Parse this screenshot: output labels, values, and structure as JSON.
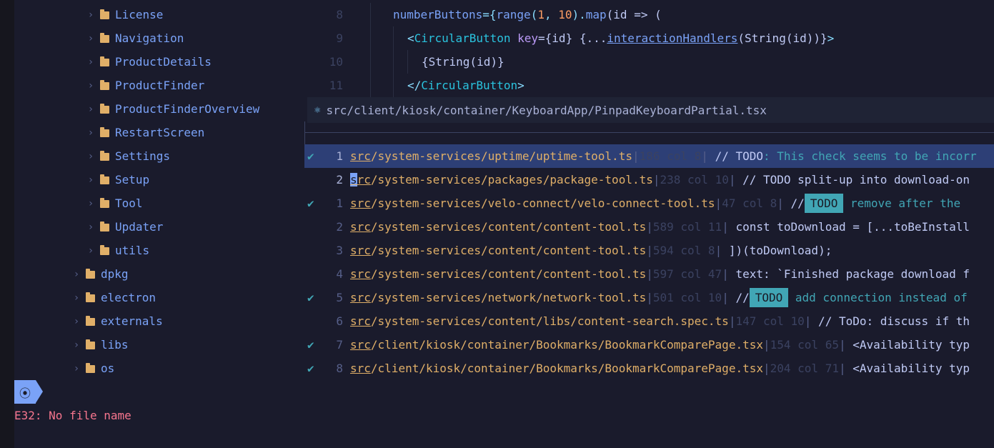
{
  "sidebar": {
    "items": [
      {
        "label": "License",
        "expanded": false
      },
      {
        "label": "Navigation",
        "expanded": false
      },
      {
        "label": "ProductDetails",
        "expanded": false
      },
      {
        "label": "ProductFinder",
        "expanded": false
      },
      {
        "label": "ProductFinderOverview",
        "expanded": false
      },
      {
        "label": "RestartScreen",
        "expanded": false
      },
      {
        "label": "Settings",
        "expanded": false
      },
      {
        "label": "Setup",
        "expanded": false
      },
      {
        "label": "Tool",
        "expanded": false
      },
      {
        "label": "Updater",
        "expanded": false
      },
      {
        "label": "utils",
        "expanded": false
      },
      {
        "label": "dpkg",
        "expanded": false
      },
      {
        "label": "electron",
        "expanded": false
      },
      {
        "label": "externals",
        "expanded": false
      },
      {
        "label": "libs",
        "expanded": false
      },
      {
        "label": "os",
        "expanded": false
      }
    ]
  },
  "code": {
    "lines": [
      {
        "num": "8",
        "indent": 2
      },
      {
        "num": "9",
        "indent": 3
      },
      {
        "num": "10",
        "indent": 4
      },
      {
        "num": "11",
        "indent": 3
      }
    ],
    "line8": {
      "prop": "numberButtons",
      "eq": "={",
      "fn": "range",
      "open": "(",
      "a": "1",
      "comma": ", ",
      "b": "10",
      "close": ").",
      "map": "map",
      "rest": "(id => ("
    },
    "line9": {
      "lt": "<",
      "tag": "CircularButton",
      "key": " key",
      "eq": "={id} {...",
      "handler": "interactionHandlers",
      "args": "(String(id))}",
      "gt": ">"
    },
    "line10": {
      "text": "{String(id)}"
    },
    "line11": {
      "lt": "</",
      "tag": "CircularButton",
      "gt": ">"
    }
  },
  "breadcrumb": {
    "icon": "react-icon",
    "path": "src/client/kiosk/container/KeyboardApp/PinpadKeyboardPartial.tsx"
  },
  "quickfix": {
    "rows": [
      {
        "checked": true,
        "num": "1",
        "src": "src",
        "path": "/system-services/uptime/uptime-tool.ts",
        "loc": "186 col 8",
        "pre": " // ",
        "todo": "TODO",
        "todo_style": "inline",
        "msg": ": This check seems to be incorr",
        "selected": true
      },
      {
        "checked": false,
        "num": "2",
        "src": "src",
        "path": "/system-services/packages/package-tool.ts",
        "loc": "238 col 10",
        "pre": " // TODO split-up into download-on",
        "todo": "",
        "todo_style": "none",
        "msg": "",
        "selected": false,
        "cursor": true
      },
      {
        "checked": true,
        "num": "1",
        "src": "src",
        "path": "/system-services/velo-connect/velo-connect-tool.ts",
        "loc": "47 col 8",
        "pre": " //",
        "todo": "TODO",
        "todo_style": "badge",
        "msg": " remove after the ",
        "selected": false
      },
      {
        "checked": false,
        "num": "2",
        "src": "src",
        "path": "/system-services/content/content-tool.ts",
        "loc": "589 col 11",
        "pre": " const toDownload = [...toBeInstall",
        "todo": "",
        "todo_style": "none",
        "msg": "",
        "selected": false
      },
      {
        "checked": false,
        "num": "3",
        "src": "src",
        "path": "/system-services/content/content-tool.ts",
        "loc": "594 col 8",
        "pre": " ])(toDownload);",
        "todo": "",
        "todo_style": "none",
        "msg": "",
        "selected": false
      },
      {
        "checked": false,
        "num": "4",
        "src": "src",
        "path": "/system-services/content/content-tool.ts",
        "loc": "597 col 47",
        "pre": " text: `Finished package download f",
        "todo": "",
        "todo_style": "none",
        "msg": "",
        "selected": false
      },
      {
        "checked": true,
        "num": "5",
        "src": "src",
        "path": "/system-services/network/network-tool.ts",
        "loc": "501 col 10",
        "pre": " //",
        "todo": "TODO",
        "todo_style": "badge",
        "msg": " add connection instead of",
        "selected": false
      },
      {
        "checked": false,
        "num": "6",
        "src": "src",
        "path": "/system-services/content/libs/content-search.spec.ts",
        "loc": "147 col 10",
        "pre": " // ToDo: discuss if th",
        "todo": "",
        "todo_style": "none",
        "msg": "",
        "selected": false
      },
      {
        "checked": true,
        "num": "7",
        "src": "src",
        "path": "/client/kiosk/container/Bookmarks/BookmarkComparePage.tsx",
        "loc": "154 col 65",
        "pre": " <Availability typ",
        "todo": "",
        "todo_style": "none",
        "msg": "",
        "selected": false
      },
      {
        "checked": true,
        "num": "8",
        "src": "src",
        "path": "/client/kiosk/container/Bookmarks/BookmarkComparePage.tsx",
        "loc": "204 col 71",
        "pre": " <Availability typ",
        "todo": "",
        "todo_style": "none",
        "msg": "",
        "selected": false
      }
    ]
  },
  "status": {
    "mode_icon": "record-icon",
    "mode_glyph": "⦿"
  },
  "cmdline": {
    "error": "E32: No file name"
  },
  "icons": {
    "check": "✔",
    "chevron": "›"
  },
  "colors": {
    "background": "#1a1b2c",
    "accent": "#7aa2f7",
    "folder": "#e0af68",
    "error": "#f7768e",
    "teal": "#41a6b5"
  }
}
